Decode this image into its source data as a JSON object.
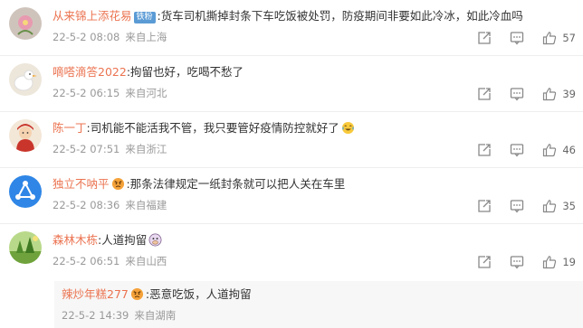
{
  "comments": [
    {
      "username": "从来锦上添花易",
      "badge": "铁粉",
      "text": "货车司机撕掉封条下车吃饭被处罚，防疫期间非要如此冷冰，如此冷血吗",
      "date": "22-5-2 08:08",
      "location": "来自上海",
      "likes": "57",
      "avatar_color": "#d6c7c0"
    },
    {
      "username": "嘀嗒滴答2022",
      "text": "拘留也好，吃喝不愁了",
      "date": "22-5-2 06:15",
      "location": "来自河北",
      "likes": "39",
      "avatar_color": "#ede6da"
    },
    {
      "username": "陈一丁",
      "text": "司机能不能活我不管，我只要管好疫情防控就好了",
      "date": "22-5-2 07:51",
      "location": "来自浙江",
      "likes": "46",
      "avatar_color": "#c9352b"
    },
    {
      "username": "独立不呐平",
      "text": "那条法律规定一纸封条就可以把人关在车里",
      "date": "22-5-2 08:36",
      "location": "来自福建",
      "likes": "35",
      "avatar_color": "#2f86e6"
    },
    {
      "username": "森林木栋",
      "text": "人道拘留",
      "date": "22-5-2 06:51",
      "location": "来自山西",
      "likes": "19",
      "avatar_color": "#8bbf5a"
    }
  ],
  "reply": {
    "username": "辣炒年糕277",
    "text": "恶意吃饭，人道拘留",
    "date": "22-5-2 14:39",
    "location": "来自湖南"
  },
  "colors": {
    "username": "#eb7350",
    "meta": "#999999",
    "divider": "#eeeeee"
  },
  "icons": {
    "share": "share-icon",
    "comment": "comment-icon",
    "like": "like-icon"
  }
}
